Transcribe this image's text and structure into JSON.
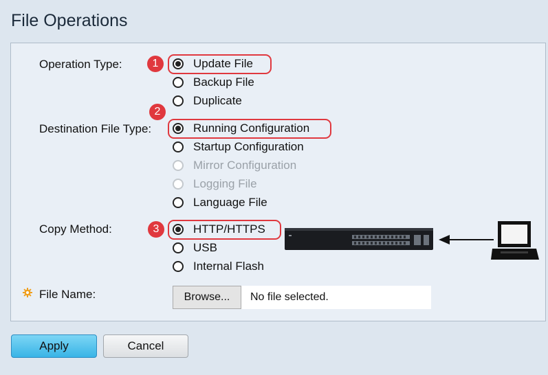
{
  "page": {
    "title": "File Operations"
  },
  "operation_type": {
    "label": "Operation Type:",
    "options": [
      {
        "label": "Update File",
        "selected": true,
        "disabled": false
      },
      {
        "label": "Backup File",
        "selected": false,
        "disabled": false
      },
      {
        "label": "Duplicate",
        "selected": false,
        "disabled": false
      }
    ],
    "step_badge": "1"
  },
  "destination_file_type": {
    "label": "Destination File Type:",
    "options": [
      {
        "label": "Running Configuration",
        "selected": true,
        "disabled": false
      },
      {
        "label": "Startup Configuration",
        "selected": false,
        "disabled": false
      },
      {
        "label": "Mirror Configuration",
        "selected": false,
        "disabled": true
      },
      {
        "label": "Logging File",
        "selected": false,
        "disabled": true
      },
      {
        "label": "Language File",
        "selected": false,
        "disabled": false
      }
    ],
    "step_badge": "2"
  },
  "copy_method": {
    "label": "Copy Method:",
    "options": [
      {
        "label": "HTTP/HTTPS",
        "selected": true,
        "disabled": false
      },
      {
        "label": "USB",
        "selected": false,
        "disabled": false
      },
      {
        "label": "Internal Flash",
        "selected": false,
        "disabled": false
      }
    ],
    "step_badge": "3"
  },
  "file_name": {
    "label": "File Name:",
    "browse_label": "Browse...",
    "status": "No file selected."
  },
  "buttons": {
    "apply": "Apply",
    "cancel": "Cancel"
  },
  "colors": {
    "highlight": "#e0383e",
    "apply_button": "#38b4e6",
    "required_icon": "#f0a020"
  },
  "icons": {
    "required": "gear-icon",
    "switch": "network-switch-icon",
    "arrow": "arrow-left-icon",
    "computer": "laptop-icon"
  }
}
